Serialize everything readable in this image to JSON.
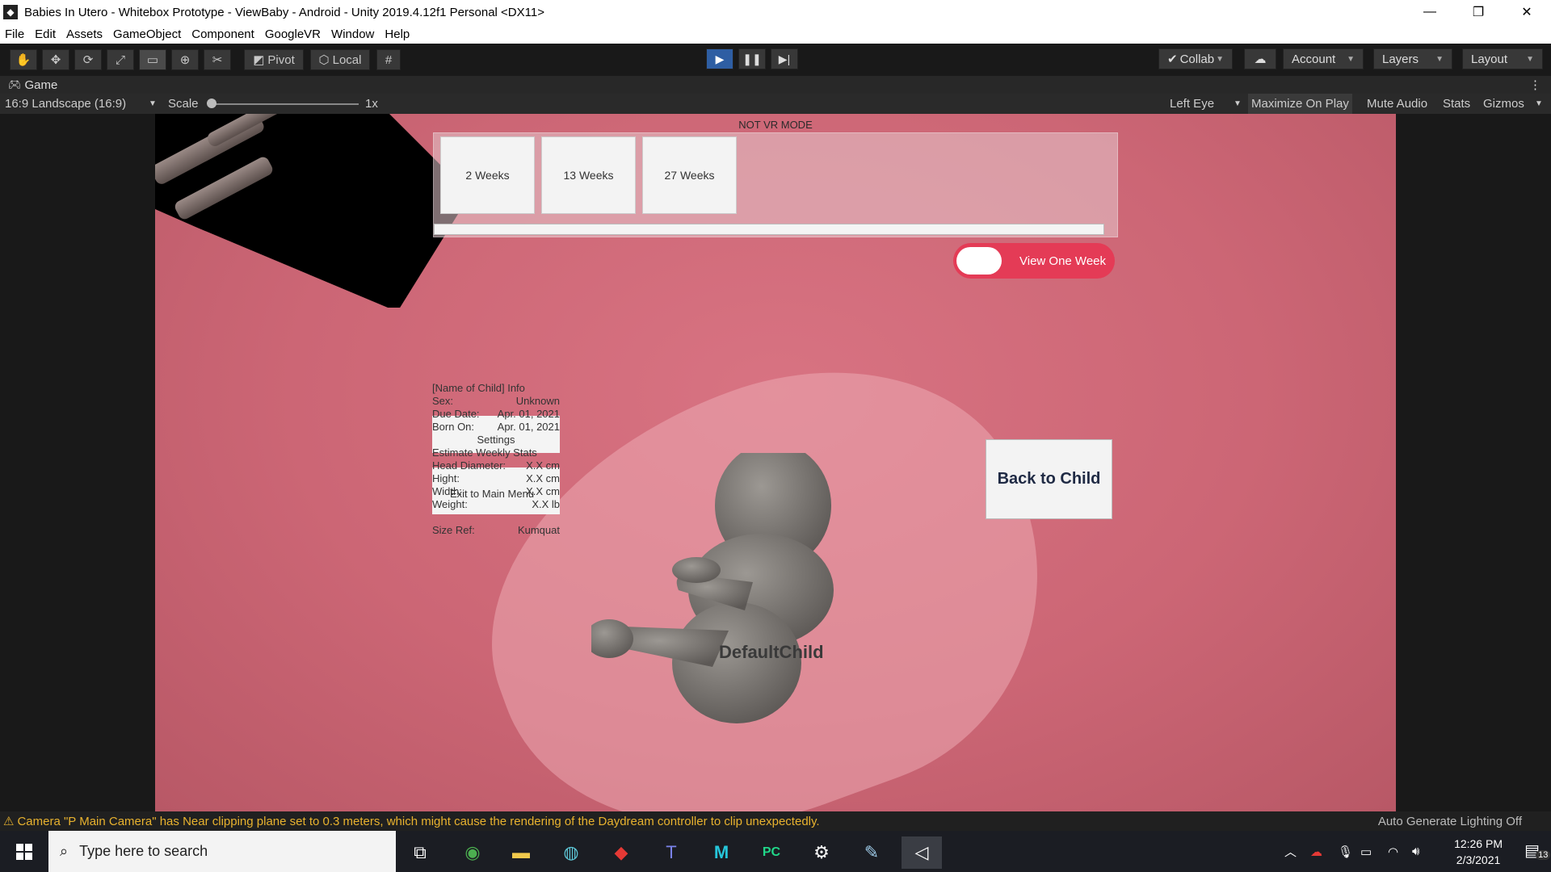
{
  "window": {
    "title": "Babies In Utero - Whitebox Prototype - ViewBaby - Android - Unity 2019.4.12f1 Personal <DX11>",
    "minimize": "—",
    "restore": "❐",
    "close": "✕"
  },
  "menu": [
    "File",
    "Edit",
    "Assets",
    "GameObject",
    "Component",
    "GoogleVR",
    "Window",
    "Help"
  ],
  "toolbar": {
    "pivot_label": "Pivot",
    "local_label": "Local",
    "collab_label": "Collab",
    "account_label": "Account",
    "layers_label": "Layers",
    "layout_label": "Layout"
  },
  "game_tab": {
    "label": "Game",
    "aspect": "16:9 Landscape (16:9)",
    "scale_label": "Scale",
    "scale_value": "1x",
    "eye": "Left Eye",
    "maximize": "Maximize On Play",
    "mute": "Mute Audio",
    "stats": "Stats",
    "gizmos": "Gizmos"
  },
  "scene": {
    "mode_label": "NOT VR MODE",
    "weeks": [
      "2 Weeks",
      "13 Weeks",
      "27 Weeks"
    ],
    "toggle_label": "View One Week",
    "back_button": "Back to Child",
    "baby_name": "DefaultChild",
    "info": {
      "title": "[Name of Child] Info",
      "sex_label": "Sex:",
      "sex_value": "Unknown",
      "due_label": "Due Date:",
      "due_value": "Apr. 01, 2021",
      "born_label": "Born On:",
      "born_value": "Apr. 01, 2021",
      "settings": "Settings",
      "estimate": "Estimate Weekly Stats",
      "head_label": "Head Diameter:",
      "head_value": "X.X cm",
      "height_label": "Hight:",
      "height_value": "X.X cm",
      "width_label": "Width:",
      "width_value": "X.X cm",
      "exit": "Exit to Main Menu",
      "weight_label": "Weight:",
      "weight_value": "X.X lb",
      "sizeref_label": "Size Ref:",
      "sizeref_value": "Kumquat"
    }
  },
  "status": {
    "warning": "Camera \"P Main Camera\" has Near clipping plane set to 0.3 meters, which might cause the rendering of the Daydream controller to clip unexpectedly.",
    "right": "Auto Generate Lighting Off"
  },
  "taskbar": {
    "search_placeholder": "Type here to search",
    "time": "12:26 PM",
    "date": "2/3/2021",
    "notifications": "13"
  }
}
